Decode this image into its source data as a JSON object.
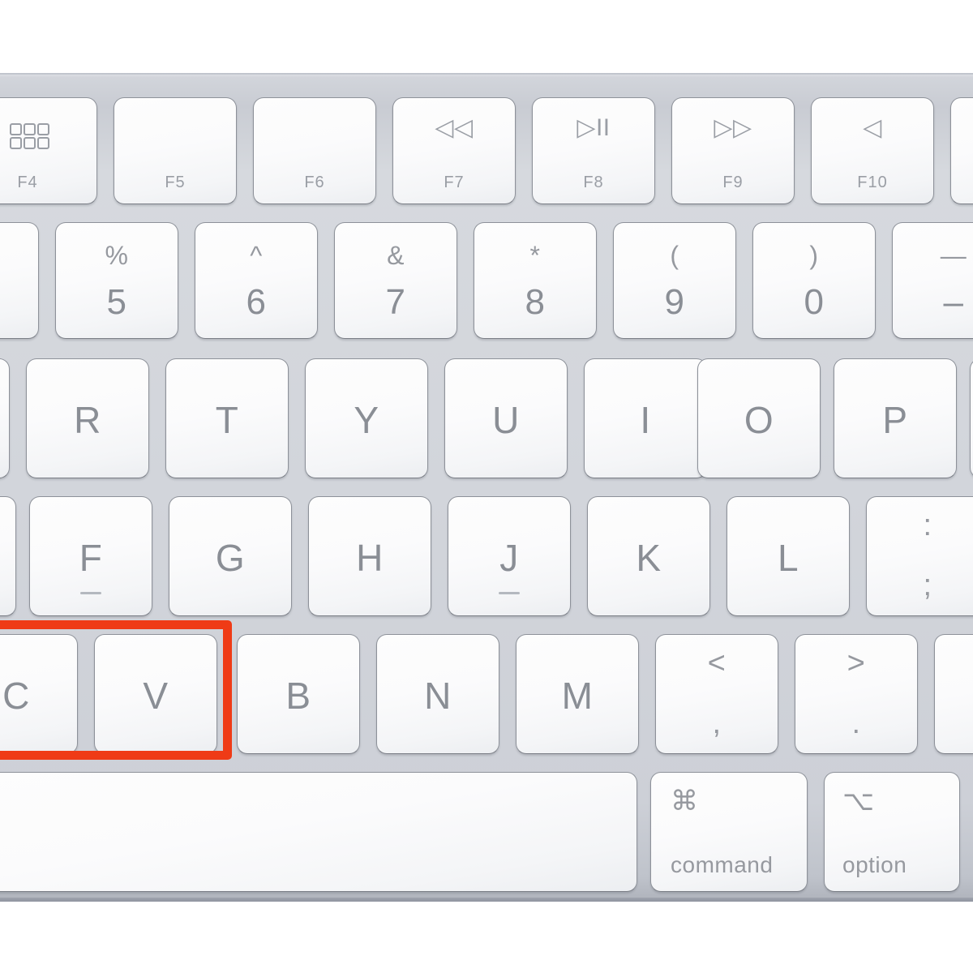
{
  "device": {
    "name": "Apple Magic Keyboard",
    "body_color": "#d2d5db",
    "key_color": "#fbfbfc",
    "legend_color": "#8b8f96",
    "highlight_color": "#ef3b16"
  },
  "highlight": {
    "label": "copy-paste-keys-highlight",
    "keys": [
      "C",
      "V"
    ],
    "color": "#ef3b16"
  },
  "rows": {
    "function_row": {
      "name": "function-key-row",
      "keys": [
        {
          "icon": "launchpad-grid-icon",
          "icon_char": "",
          "fn": "F4"
        },
        {
          "icon": "none",
          "icon_char": "",
          "fn": "F5"
        },
        {
          "icon": "none",
          "icon_char": "",
          "fn": "F6"
        },
        {
          "icon": "rewind-icon",
          "icon_char": "◁◁",
          "fn": "F7"
        },
        {
          "icon": "play-pause-icon",
          "icon_char": "▷II",
          "fn": "F8"
        },
        {
          "icon": "fast-forward-icon",
          "icon_char": "▷▷",
          "fn": "F9"
        },
        {
          "icon": "mute-icon",
          "icon_char": "◁",
          "fn": "F10"
        },
        {
          "icon": "none",
          "icon_char": "",
          "fn": ""
        }
      ]
    },
    "number_row": {
      "name": "number-key-row",
      "keys": [
        {
          "sup": "",
          "main": ""
        },
        {
          "sup": "%",
          "main": "5"
        },
        {
          "sup": "^",
          "main": "6"
        },
        {
          "sup": "&",
          "main": "7"
        },
        {
          "sup": "*",
          "main": "8"
        },
        {
          "sup": "(",
          "main": "9"
        },
        {
          "sup": ")",
          "main": "0"
        },
        {
          "sup": "—",
          "main": "–"
        }
      ]
    },
    "qwerty_row": {
      "name": "qwerty-letter-row",
      "keys": [
        {
          "main": ""
        },
        {
          "main": "R"
        },
        {
          "main": "T"
        },
        {
          "main": "Y"
        },
        {
          "main": "U"
        },
        {
          "main": "I"
        },
        {
          "main": "O"
        },
        {
          "main": "P"
        },
        {
          "main": ""
        }
      ]
    },
    "home_row": {
      "name": "home-letter-row",
      "keys": [
        {
          "main": "",
          "bump": false
        },
        {
          "main": "F",
          "bump": true
        },
        {
          "main": "G",
          "bump": false
        },
        {
          "main": "H",
          "bump": false
        },
        {
          "main": "J",
          "bump": true
        },
        {
          "main": "K",
          "bump": false
        },
        {
          "main": "L",
          "bump": false
        },
        {
          "main": "",
          "sup": ":",
          "sub": ";",
          "bump": false
        }
      ]
    },
    "zxcv_row": {
      "name": "zxcv-letter-row",
      "keys": [
        {
          "main": "C",
          "highlighted": true
        },
        {
          "main": "V",
          "highlighted": true
        },
        {
          "main": "B",
          "highlighted": false
        },
        {
          "main": "N",
          "highlighted": false
        },
        {
          "main": "M",
          "highlighted": false
        },
        {
          "main": "",
          "sup": "<",
          "sub": ",",
          "highlighted": false
        },
        {
          "main": "",
          "sup": ">",
          "sub": ".",
          "highlighted": false
        },
        {
          "main": "",
          "highlighted": false
        }
      ]
    },
    "bottom_row": {
      "name": "modifier-row",
      "keys": [
        {
          "type": "space",
          "symbol": "",
          "label": ""
        },
        {
          "type": "mod",
          "symbol": "⌘",
          "label": "command",
          "icon": "command-icon"
        },
        {
          "type": "mod",
          "symbol": "⌥",
          "label": "option",
          "icon": "option-icon"
        },
        {
          "type": "mod",
          "symbol": "",
          "label": "",
          "icon": "none"
        }
      ]
    }
  }
}
